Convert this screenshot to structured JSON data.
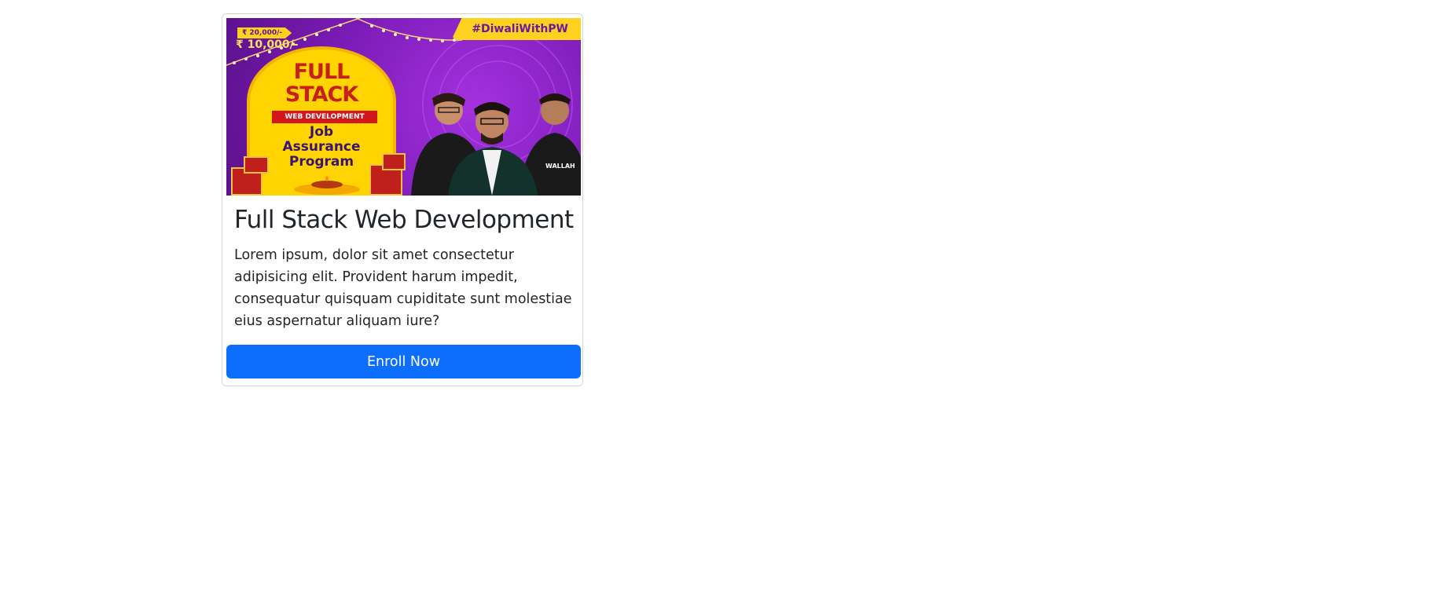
{
  "card": {
    "banner": {
      "hashtag": "#DiwaliWithPW",
      "old_price": "₹ 20,000/-",
      "new_price": "₹ 10,000/-",
      "headline_line1": "FULL",
      "headline_line2": "STACK",
      "ribbon": "WEB DEVELOPMENT",
      "subtitle_line1": "Job",
      "subtitle_line2": "Assurance",
      "subtitle_line3": "Program",
      "shirt_text": "WALLAH"
    },
    "title": "Full Stack Web Development",
    "description": "Lorem ipsum, dolor sit amet consectetur adipisicing elit. Provident harum impedit, consequatur quisquam cupiditate sunt molestiae eius aspernatur aliquam iure?",
    "button_label": "Enroll Now"
  },
  "colors": {
    "button": "#0d6efd",
    "banner_purple": "#7b1bb6",
    "banner_yellow": "#ffd400"
  }
}
